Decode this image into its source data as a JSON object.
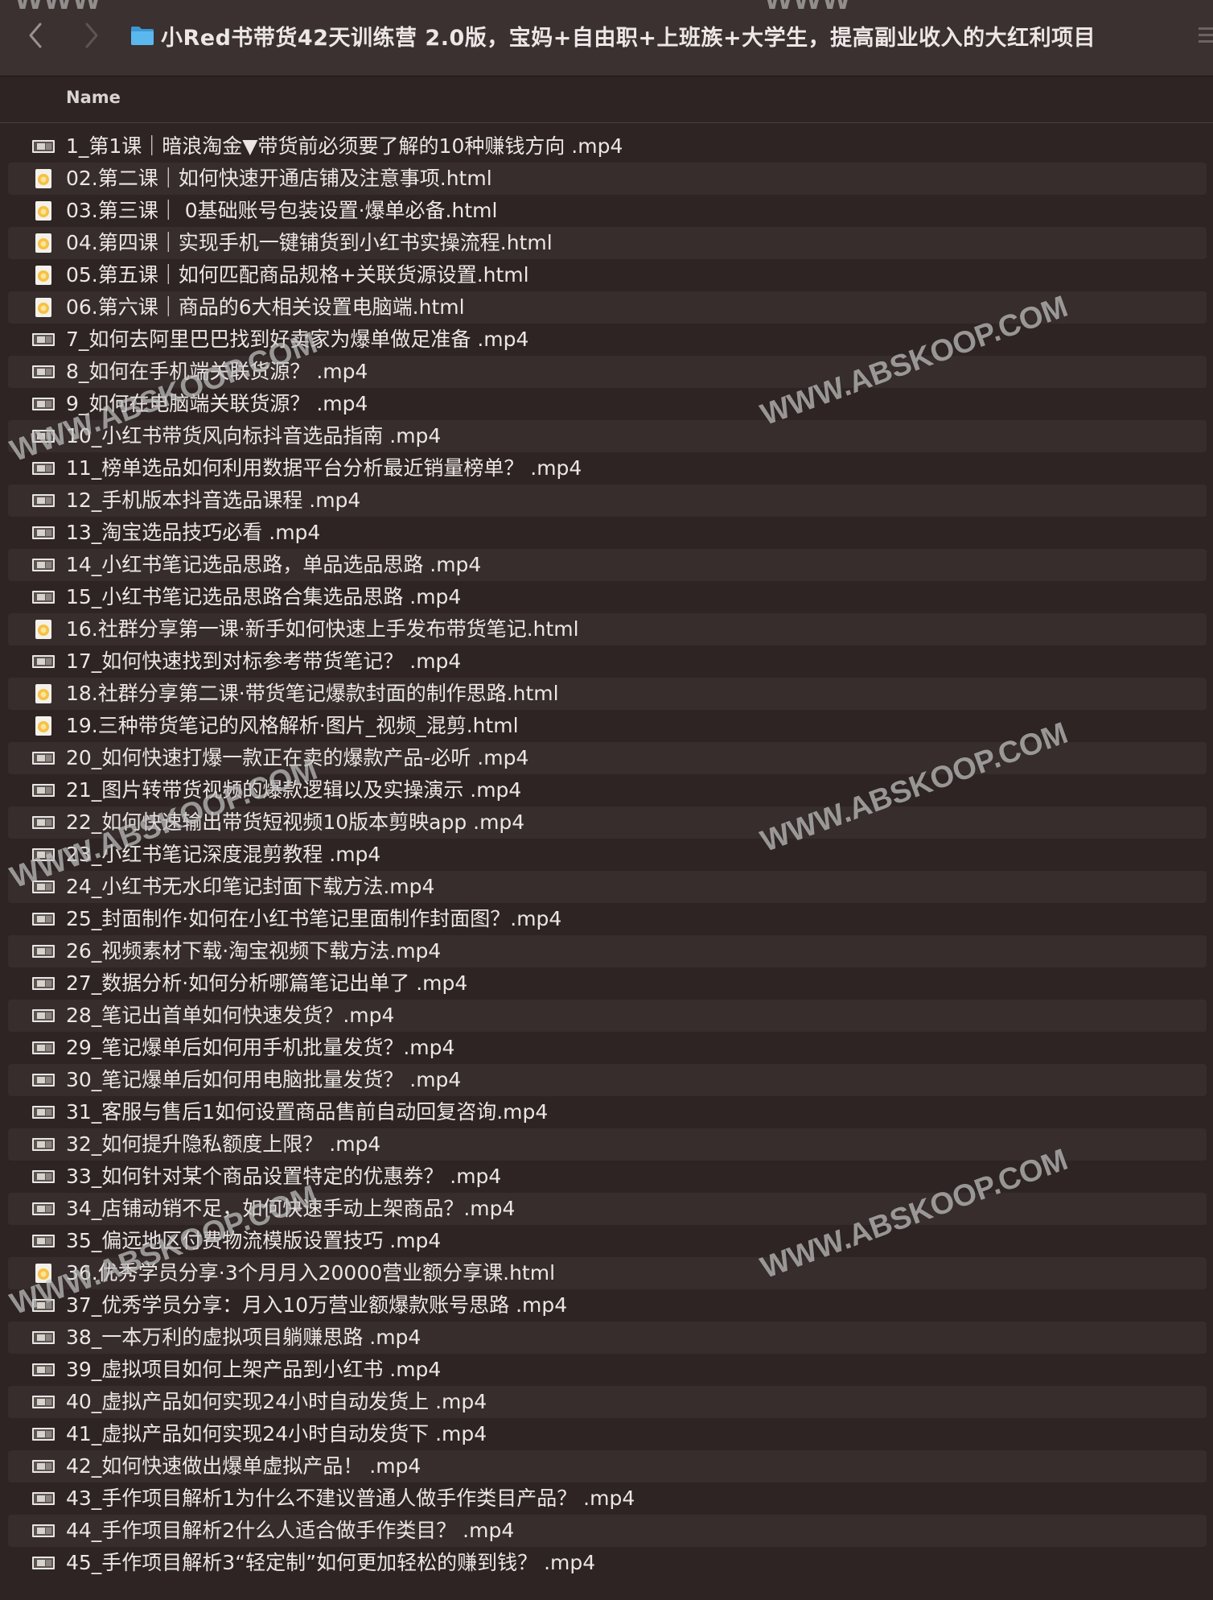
{
  "window": {
    "title": "小Red书带货42天训练营 2.0版，宝妈+自由职+上班族+大学生，提高副业收入的大红利项目"
  },
  "list_header": {
    "name_label": "Name"
  },
  "watermark_text": "WWW.ABSKOOP.COM",
  "top_watermark_text": "WWW",
  "files": [
    {
      "name": "1_第1课｜暗浪淘金▼带货前必须要了解的10种赚钱方向 .mp4",
      "icon": "video-icon"
    },
    {
      "name": "02.第二课｜如何快速开通店铺及注意事项.html",
      "icon": "html-icon"
    },
    {
      "name": "03.第三课｜ 0基础账号包装设置·爆单必备.html",
      "icon": "html-icon"
    },
    {
      "name": "04.第四课｜实现手机一键铺货到小红书实操流程.html",
      "icon": "html-icon"
    },
    {
      "name": "05.第五课｜如何匹配商品规格+关联货源设置.html",
      "icon": "html-icon"
    },
    {
      "name": "06.第六课｜商品的6大相关设置电脑端.html",
      "icon": "html-icon"
    },
    {
      "name": "7_如何去阿里巴巴找到好卖家为爆单做足准备 .mp4",
      "icon": "video-icon"
    },
    {
      "name": "8_如何在手机端关联货源？ .mp4",
      "icon": "video-icon"
    },
    {
      "name": "9_如何在电脑端关联货源？ .mp4",
      "icon": "video-icon"
    },
    {
      "name": "10_小红书带货风向标抖音选品指南 .mp4",
      "icon": "video-icon"
    },
    {
      "name": "11_榜单选品如何利用数据平台分析最近销量榜单？ .mp4",
      "icon": "video-icon"
    },
    {
      "name": "12_手机版本抖音选品课程 .mp4",
      "icon": "video-icon"
    },
    {
      "name": "13_淘宝选品技巧必看 .mp4",
      "icon": "video-icon"
    },
    {
      "name": "14_小红书笔记选品思路，单品选品思路 .mp4",
      "icon": "video-icon"
    },
    {
      "name": "15_小红书笔记选品思路合集选品思路 .mp4",
      "icon": "video-icon"
    },
    {
      "name": "16.社群分享第一课·新手如何快速上手发布带货笔记.html",
      "icon": "html-icon"
    },
    {
      "name": "17_如何快速找到对标参考带货笔记？ .mp4",
      "icon": "video-icon"
    },
    {
      "name": "18.社群分享第二课·带货笔记爆款封面的制作思路.html",
      "icon": "html-icon"
    },
    {
      "name": "19.三种带货笔记的风格解析·图片_视频_混剪.html",
      "icon": "html-icon"
    },
    {
      "name": "20_如何快速打爆一款正在卖的爆款产品-必听 .mp4",
      "icon": "video-icon"
    },
    {
      "name": "21_图片转带货视频的爆款逻辑以及实操演示 .mp4",
      "icon": "video-icon"
    },
    {
      "name": "22_如何快速输出带货短视频10版本剪映app .mp4",
      "icon": "video-icon"
    },
    {
      "name": "23_小红书笔记深度混剪教程 .mp4",
      "icon": "video-icon"
    },
    {
      "name": "24_小红书无水印笔记封面下载方法.mp4",
      "icon": "video-icon"
    },
    {
      "name": "25_封面制作·如何在小红书笔记里面制作封面图？.mp4",
      "icon": "video-icon"
    },
    {
      "name": "26_视频素材下载·淘宝视频下载方法.mp4",
      "icon": "video-icon"
    },
    {
      "name": "27_数据分析·如何分析哪篇笔记出单了 .mp4",
      "icon": "video-icon"
    },
    {
      "name": "28_笔记出首单如何快速发货？.mp4",
      "icon": "video-icon"
    },
    {
      "name": "29_笔记爆单后如何用手机批量发货？.mp4",
      "icon": "video-icon"
    },
    {
      "name": "30_笔记爆单后如何用电脑批量发货？ .mp4",
      "icon": "video-icon"
    },
    {
      "name": "31_客服与售后1如何设置商品售前自动回复咨询.mp4",
      "icon": "video-icon"
    },
    {
      "name": "32_如何提升隐私额度上限？ .mp4",
      "icon": "video-icon"
    },
    {
      "name": "33_如何针对某个商品设置特定的优惠券？ .mp4",
      "icon": "video-icon"
    },
    {
      "name": "34_店铺动销不足，如何快速手动上架商品？.mp4",
      "icon": "video-icon"
    },
    {
      "name": "35_偏远地区付费物流模版设置技巧 .mp4",
      "icon": "video-icon"
    },
    {
      "name": "36.优秀学员分享·3个月月入20000营业额分享课.html",
      "icon": "html-icon"
    },
    {
      "name": "37_优秀学员分享：月入10万营业额爆款账号思路 .mp4",
      "icon": "video-icon"
    },
    {
      "name": "38_一本万利的虚拟项目躺赚思路 .mp4",
      "icon": "video-icon"
    },
    {
      "name": "39_虚拟项目如何上架产品到小红书 .mp4",
      "icon": "video-icon"
    },
    {
      "name": "40_虚拟产品如何实现24小时自动发货上 .mp4",
      "icon": "video-icon"
    },
    {
      "name": "41_虚拟产品如何实现24小时自动发货下 .mp4",
      "icon": "video-icon"
    },
    {
      "name": "42_如何快速做出爆单虚拟产品！ .mp4",
      "icon": "video-icon"
    },
    {
      "name": "43_手作项目解析1为什么不建议普通人做手作类目产品？ .mp4",
      "icon": "video-icon"
    },
    {
      "name": "44_手作项目解析2什么人适合做手作类目？ .mp4",
      "icon": "video-icon"
    },
    {
      "name": "45_手作项目解析3“轻定制”如何更加轻松的赚到钱？ .mp4",
      "icon": "video-icon"
    }
  ],
  "colors": {
    "background": "#2d2423",
    "row_alt": "#362d2c",
    "titlebar": "#3a3130",
    "folder_blue": "#4fb1e8",
    "html_icon": "#f6c143"
  }
}
